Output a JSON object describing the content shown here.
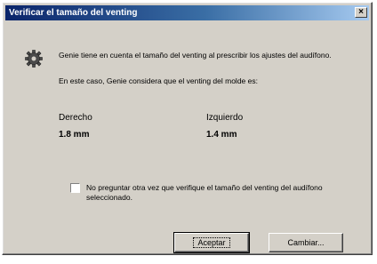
{
  "window": {
    "title": "Verificar el tamaño del venting",
    "close_label": "×"
  },
  "message": {
    "icon": "gear-icon",
    "info": "Genie tiene en cuenta el tamaño del venting al prescribir los ajustes del audífono.",
    "case": "En este caso, Genie considera que el venting del molde es:"
  },
  "venting": {
    "right_label": "Derecho",
    "right_value": "1.8 mm",
    "left_label": "Izquierdo",
    "left_value": "1.4 mm"
  },
  "option": {
    "checked": false,
    "label": "No preguntar otra vez que verifique el tamaño del venting del audífono seleccionado."
  },
  "buttons": {
    "accept": "Aceptar",
    "change": "Cambiar..."
  }
}
